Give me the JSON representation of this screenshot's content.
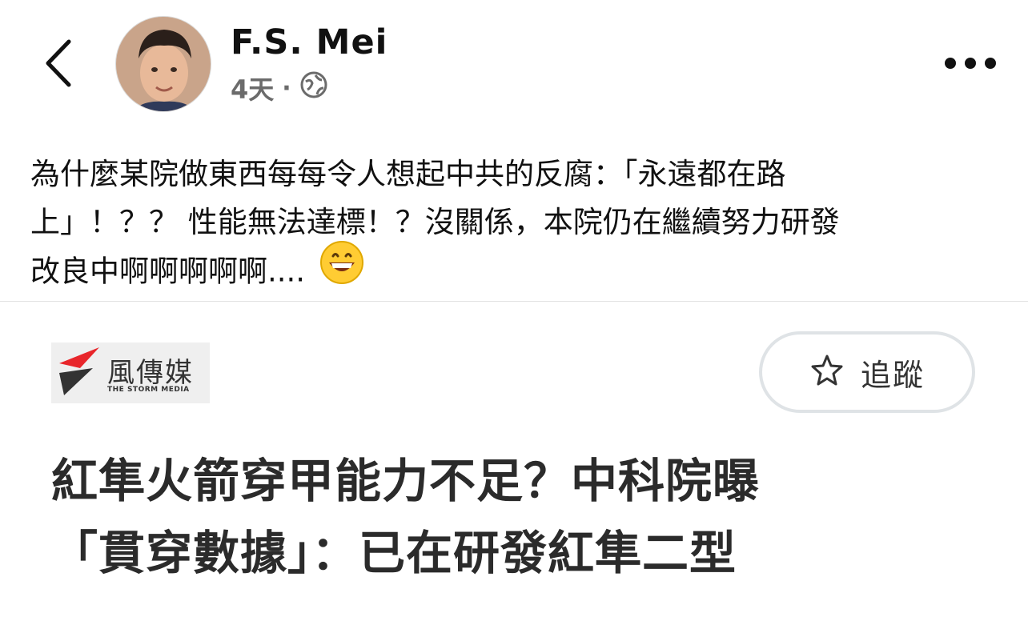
{
  "header": {
    "author_name": "F.S. Mei",
    "time": "4天",
    "separator": "·",
    "privacy_icon": "globe-icon",
    "back_icon": "chevron-left-icon",
    "more_icon": "more-horizontal-icon"
  },
  "post": {
    "text_lines": [
      "為什麼某院做東西每每令人想起中共的反腐：「永遠都在路",
      "上」！？？ 性能無法達標！？沒關係，本院仍在繼續努力研發",
      "改良中啊啊啊啊啊...."
    ],
    "emoji": "grinning-face-emoji"
  },
  "shared_card": {
    "publisher_name": "風傳媒",
    "publisher_name_en": "THE STORM MEDIA",
    "follow_label": "追蹤",
    "follow_icon": "star-outline-icon",
    "headline_lines": [
      "紅隼火箭穿甲能力不足？中科院曝",
      "「貫穿數據」：已在研發紅隼二型"
    ]
  },
  "colors": {
    "text_primary": "#111111",
    "text_secondary": "#6b6b6b",
    "divider": "#e2e2e2",
    "logo_red": "#e8262b",
    "logo_dark": "#333333"
  }
}
